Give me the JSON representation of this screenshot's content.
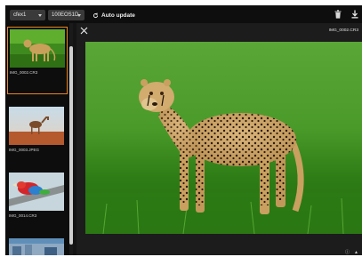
{
  "toolbar": {
    "camera_select": "cfex1",
    "folder_select": "100EOS1D",
    "auto_update_label": "Auto update"
  },
  "sidebar": {
    "thumbnails": [
      {
        "filename": "IMG_0002.CR3",
        "selected": true
      },
      {
        "filename": "IMG_0003.JPEG",
        "selected": false
      },
      {
        "filename": "IMG_0014.CR3",
        "selected": false
      }
    ]
  },
  "viewer": {
    "filename": "IMG_0002.CR3",
    "icons": [
      "close-icon",
      "info-icon",
      "lock-icon"
    ]
  },
  "colors": {
    "accent": "#e88424",
    "background": "#141414"
  }
}
